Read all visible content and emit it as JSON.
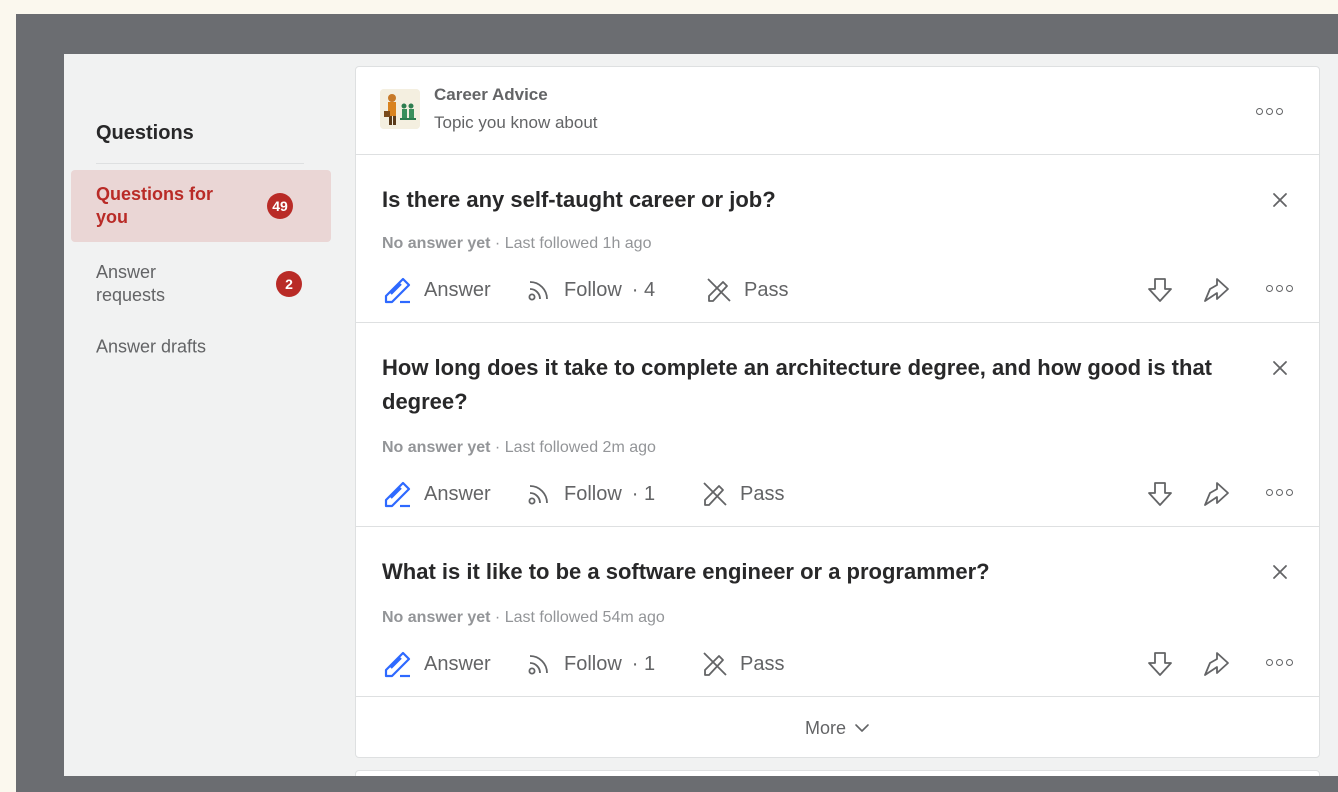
{
  "sidebar": {
    "title": "Questions",
    "items": [
      {
        "label": "Questions for you",
        "badge": "49",
        "active": true
      },
      {
        "label": "Answer requests",
        "badge": "2",
        "active": false
      },
      {
        "label": "Answer drafts",
        "badge": "",
        "active": false
      }
    ]
  },
  "topic": {
    "name": "Career Advice",
    "subtitle": "Topic you know about"
  },
  "questions": [
    {
      "title": "Is there any self-taught career or job?",
      "status": "No answer yet",
      "followed": " · Last followed 1h ago",
      "answer_label": "Answer",
      "follow_label": "Follow",
      "follow_count": "· 4",
      "pass_label": "Pass"
    },
    {
      "title": "How long does it take to complete an architecture degree, and how good is that degree?",
      "status": "No answer yet",
      "followed": " · Last followed 2m ago",
      "answer_label": "Answer",
      "follow_label": "Follow",
      "follow_count": "· 1",
      "pass_label": "Pass"
    },
    {
      "title": "What is it like to be a software engineer or a programmer?",
      "status": "No answer yet",
      "followed": " · Last followed 54m ago",
      "answer_label": "Answer",
      "follow_label": "Follow",
      "follow_count": "· 1",
      "pass_label": "Pass"
    }
  ],
  "more_label": "More",
  "colors": {
    "accent": "#b92b27",
    "active_bg": "#ead6d5",
    "answer_icon": "#2e69ff",
    "text_muted": "#636466",
    "frame": "#6b6d71"
  },
  "icons": {
    "answer": "pencil-answer-icon",
    "follow": "rss-follow-icon",
    "pass": "pencil-slash-pass-icon",
    "downvote": "downvote-arrow-icon",
    "share": "share-arrow-icon",
    "overflow": "more-dots-icon",
    "close": "close-icon",
    "more": "chevron-down-icon"
  }
}
